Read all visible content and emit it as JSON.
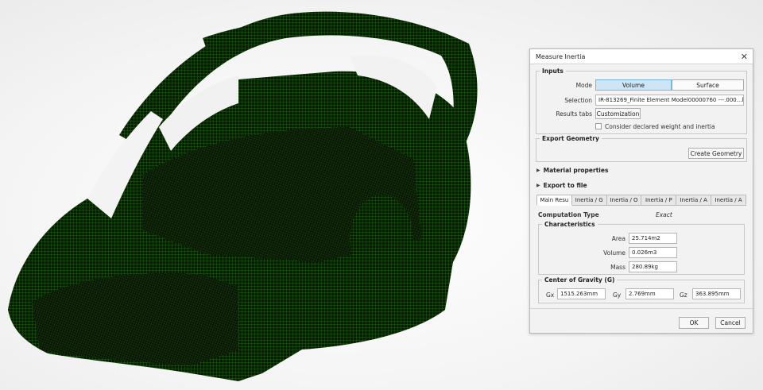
{
  "dialog": {
    "title": "Measure Inertia",
    "close_icon": "close-icon"
  },
  "inputs": {
    "legend": "Inputs",
    "mode_label": "Mode",
    "mode_options": [
      "Volume",
      "Surface"
    ],
    "mode_selected": "Volume",
    "selection_label": "Selection",
    "selection_value": "IR-813269_Finite Element Model00000760 ---.000...l",
    "results_tabs_label": "Results tabs",
    "customization_label": "Customization",
    "consider_label": "Consider declared weight and inertia",
    "consider_checked": false
  },
  "export_geometry": {
    "legend": "Export Geometry",
    "create_label": "Create Geometry"
  },
  "material_properties": {
    "label": "Material properties"
  },
  "export_to_file": {
    "label": "Export to file"
  },
  "tabs": [
    "Main Resu",
    "Inertia / G",
    "Inertia / O",
    "Inertia / P",
    "Inertia / A",
    "Inertia / A"
  ],
  "results": {
    "computation_type_label": "Computation Type",
    "computation_type_value": "Exact",
    "characteristics": {
      "legend": "Characteristics",
      "area_label": "Area",
      "area_value": "25.714m2",
      "volume_label": "Volume",
      "volume_value": "0.026m3",
      "mass_label": "Mass",
      "mass_value": "280.89kg"
    },
    "center_of_gravity": {
      "legend": "Center of Gravity (G)",
      "gx_label": "Gx",
      "gx_value": "1515.263mm",
      "gy_label": "Gy",
      "gy_value": "2.769mm",
      "gz_label": "Gz",
      "gz_value": "363.895mm"
    }
  },
  "footer": {
    "ok_label": "OK",
    "cancel_label": "Cancel"
  },
  "colors": {
    "mesh_green": "#1f5a12",
    "mesh_dark": "#0b1a07",
    "active_segment": "#cde6f7"
  }
}
